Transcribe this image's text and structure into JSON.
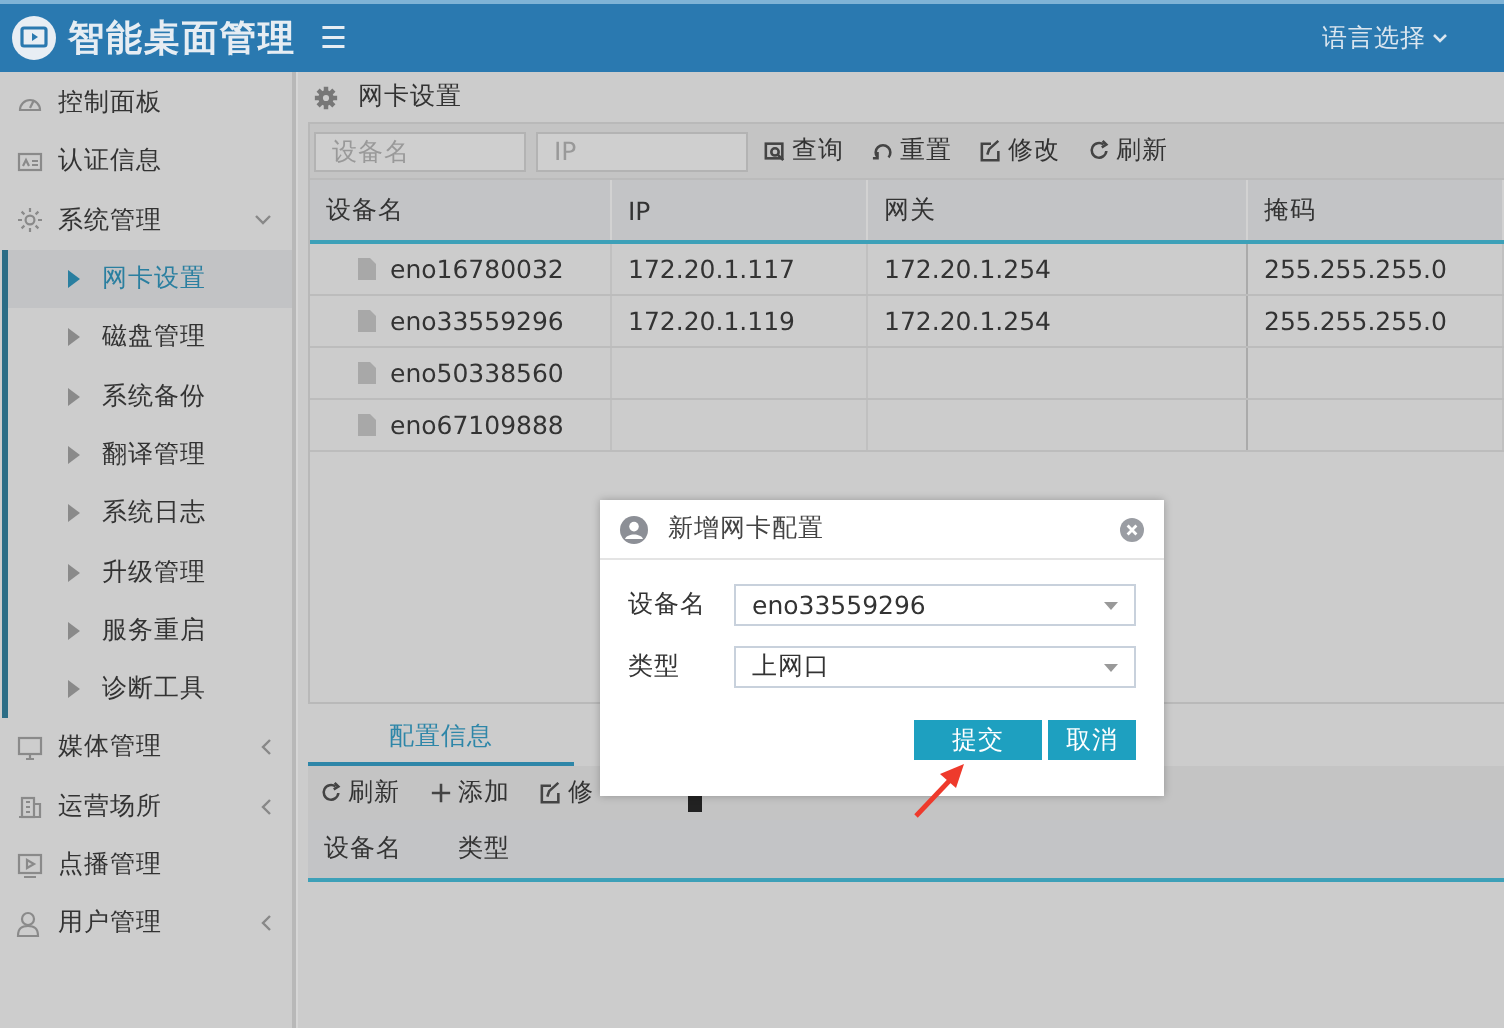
{
  "header": {
    "title": "智能桌面管理",
    "menu_glyph": "☰",
    "language_menu": "语言选择"
  },
  "sidebar": {
    "items": [
      {
        "label": "控制面板"
      },
      {
        "label": "认证信息"
      },
      {
        "label": "系统管理",
        "expanded": true,
        "children": [
          {
            "label": "网卡设置",
            "selected": true
          },
          {
            "label": "磁盘管理",
            "selected": false
          },
          {
            "label": "系统备份",
            "selected": false
          },
          {
            "label": "翻译管理",
            "selected": false
          },
          {
            "label": "系统日志",
            "selected": false
          },
          {
            "label": "升级管理",
            "selected": false
          },
          {
            "label": "服务重启",
            "selected": false
          },
          {
            "label": "诊断工具",
            "selected": false
          }
        ]
      },
      {
        "label": "媒体管理",
        "expanded": false
      },
      {
        "label": "运营场所",
        "expanded": false
      },
      {
        "label": "点播管理"
      },
      {
        "label": "用户管理",
        "expanded": false
      }
    ]
  },
  "page": {
    "breadcrumb": "网卡设置",
    "filters": [
      {
        "placeholder": "设备名"
      },
      {
        "placeholder": "IP"
      }
    ],
    "toolbar": [
      "查询",
      "重置",
      "修改",
      "刷新"
    ],
    "table": {
      "columns": [
        "设备名",
        "IP",
        "网关",
        "掩码"
      ],
      "rows": [
        {
          "name": "eno16780032",
          "ip": "172.20.1.117",
          "gateway": "172.20.1.254",
          "mask": "255.255.255.0"
        },
        {
          "name": "eno33559296",
          "ip": "172.20.1.119",
          "gateway": "172.20.1.254",
          "mask": "255.255.255.0"
        },
        {
          "name": "eno50338560"
        },
        {
          "name": "eno67109888"
        }
      ]
    },
    "bottom_tabs": [
      {
        "label": "配置信息",
        "selected": true
      }
    ],
    "bottom_toolbar": [
      "刷新",
      "添加",
      "修"
    ],
    "bottom_table": {
      "columns": [
        "设备名",
        "类型"
      ]
    }
  },
  "dialog": {
    "title": "新增网卡配置",
    "fields": [
      {
        "label": "设备名",
        "value": "eno33559296"
      },
      {
        "label": "类型",
        "value": "上网口"
      }
    ],
    "buttons": [
      "提交",
      "取消"
    ]
  }
}
